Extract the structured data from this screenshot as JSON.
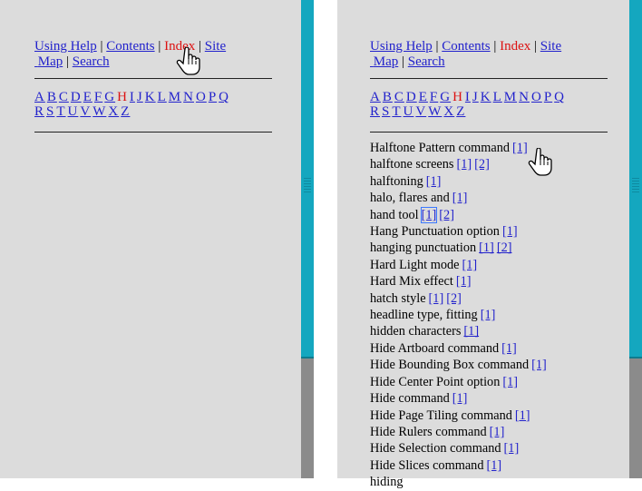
{
  "nav": {
    "using_help": "Using Help",
    "contents": "Contents",
    "index": "Index",
    "site": "Site",
    "map": "Map",
    "search": "Search",
    "sep": "|"
  },
  "alphabet_row1": [
    "A",
    "B",
    "C",
    "D",
    "E",
    "F",
    "G",
    "H",
    "I",
    "J",
    "K",
    "L",
    "M",
    "N",
    "O",
    "P",
    "Q"
  ],
  "alphabet_row2": [
    "R",
    "S",
    "T",
    "U",
    "V",
    "W",
    "X",
    "Z"
  ],
  "active_letter": "H",
  "entries": [
    {
      "term": "Halftone Pattern command",
      "refs": [
        "[1]"
      ]
    },
    {
      "term": "halftone screens",
      "refs": [
        "[1]",
        "[2]"
      ]
    },
    {
      "term": "halftoning",
      "refs": [
        "[1]"
      ]
    },
    {
      "term": "halo, flares and",
      "refs": [
        "[1]"
      ]
    },
    {
      "term": "hand tool",
      "refs": [
        "[1]",
        "[2]"
      ]
    },
    {
      "term": "Hang Punctuation option",
      "refs": [
        "[1]"
      ]
    },
    {
      "term": "hanging punctuation",
      "refs": [
        "[1]",
        "[2]"
      ]
    },
    {
      "term": "Hard Light mode",
      "refs": [
        "[1]"
      ]
    },
    {
      "term": "Hard Mix effect",
      "refs": [
        "[1]"
      ]
    },
    {
      "term": "hatch style",
      "refs": [
        "[1]",
        "[2]"
      ]
    },
    {
      "term": "headline type, fitting",
      "refs": [
        "[1]"
      ]
    },
    {
      "term": "hidden characters",
      "refs": [
        "[1]"
      ]
    },
    {
      "term": "Hide Artboard command",
      "refs": [
        "[1]"
      ]
    },
    {
      "term": "Hide Bounding Box command",
      "refs": [
        "[1]"
      ]
    },
    {
      "term": "Hide Center Point option",
      "refs": [
        "[1]"
      ]
    },
    {
      "term": "Hide command",
      "refs": [
        "[1]"
      ]
    },
    {
      "term": "Hide Page Tiling command",
      "refs": [
        "[1]"
      ]
    },
    {
      "term": "Hide Rulers command",
      "refs": [
        "[1]"
      ]
    },
    {
      "term": "Hide Selection command",
      "refs": [
        "[1]"
      ]
    },
    {
      "term": "Hide Slices command",
      "refs": [
        "[1]"
      ]
    },
    {
      "term": "hiding",
      "refs": []
    }
  ],
  "colors": {
    "link": "#2222cc",
    "current": "#dd1111",
    "panel": "#dcdcdc",
    "frame_cyan": "#14a7bf",
    "frame_grey": "#8b8b8b"
  },
  "icons": {
    "cursor": "hand-pointer-icon"
  }
}
